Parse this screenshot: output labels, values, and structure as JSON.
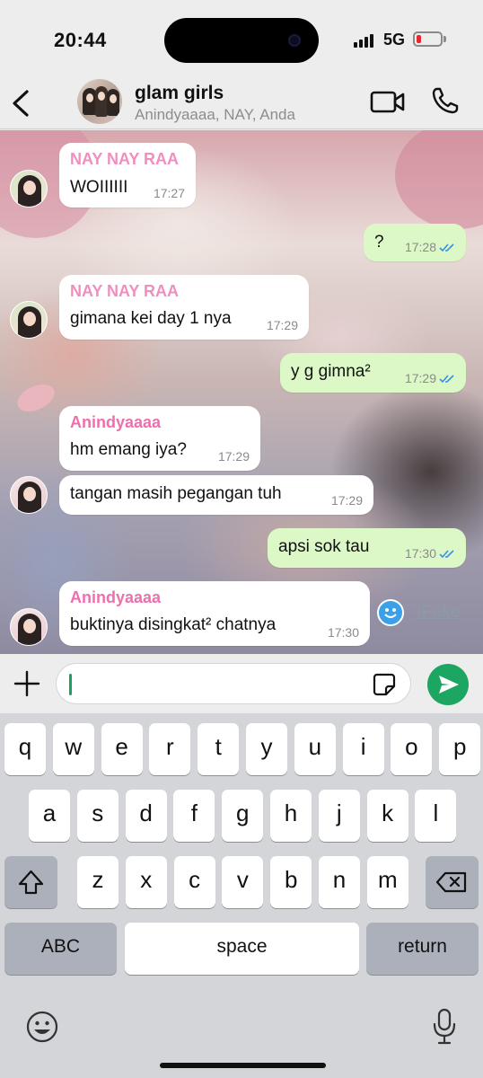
{
  "status": {
    "time": "20:44",
    "network": "5G",
    "battery_level": 0.2,
    "battery_color": "#e8272d"
  },
  "header": {
    "title": "glam girls",
    "subtitle": "Anindyaaaa, NAY, Anda",
    "icons": {
      "back": "chevron-left-icon",
      "video": "video-camera-icon",
      "call": "phone-icon"
    }
  },
  "colors": {
    "sender_nay": "#f08fbf",
    "sender_anindya": "#ee6fae",
    "outgoing_bubble": "#dcf8c6",
    "read_tick": "#3b8fe0",
    "send_button": "#1da562"
  },
  "messages": [
    {
      "sender": "NAY NAY RAA",
      "text": "WOIIIIII",
      "time": "17:27",
      "direction": "in"
    },
    {
      "text": "?",
      "time": "17:28",
      "direction": "out",
      "read": true
    },
    {
      "sender": "NAY NAY RAA",
      "text": "gimana kei day 1 nya",
      "time": "17:29",
      "direction": "in"
    },
    {
      "text": "y g gimna²",
      "time": "17:29",
      "direction": "out",
      "read": true
    },
    {
      "sender": "Anindyaaaa",
      "text": "hm emang iya?",
      "time": "17:29",
      "direction": "in"
    },
    {
      "text": "tangan masih pegangan tuh",
      "time": "17:29",
      "direction": "in"
    },
    {
      "text": "apsi sok tau",
      "time": "17:30",
      "direction": "out",
      "read": true
    },
    {
      "sender": "Anindyaaaa",
      "text": "buktinya disingkat² chatnya",
      "time": "17:30",
      "direction": "in"
    }
  ],
  "watermark": "iFake",
  "input": {
    "value": "",
    "placeholder": ""
  },
  "keyboard": {
    "row1": [
      "q",
      "w",
      "e",
      "r",
      "t",
      "y",
      "u",
      "i",
      "o",
      "p"
    ],
    "row2": [
      "a",
      "s",
      "d",
      "f",
      "g",
      "h",
      "j",
      "k",
      "l"
    ],
    "row3": [
      "z",
      "x",
      "c",
      "v",
      "b",
      "n",
      "m"
    ],
    "abc": "ABC",
    "space": "space",
    "return": "return"
  }
}
